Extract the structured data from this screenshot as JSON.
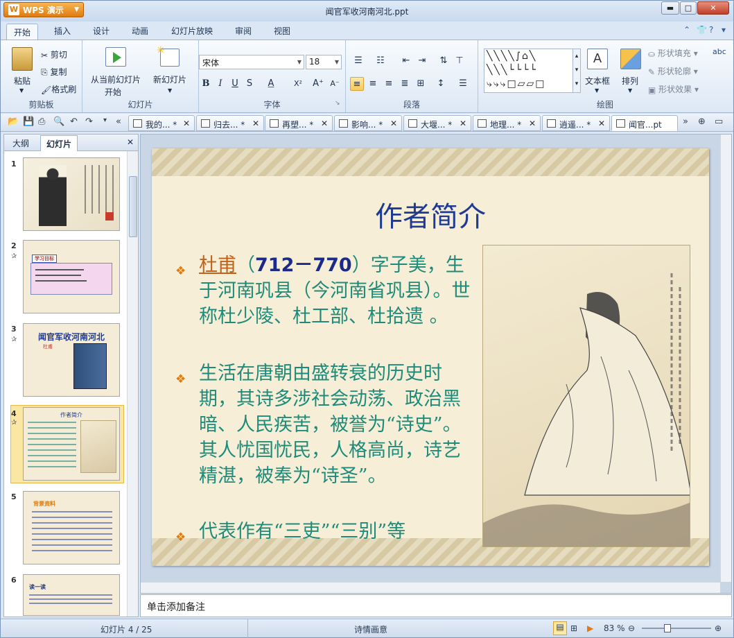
{
  "app": {
    "name": "WPS 演示",
    "window_title": "闻官军收河南河北.ppt"
  },
  "window_controls": {
    "minimize": "▬",
    "maximize": "□",
    "close": "✕"
  },
  "ribbon_tabs": [
    "开始",
    "插入",
    "设计",
    "动画",
    "幻灯片放映",
    "审阅",
    "视图"
  ],
  "clipboard": {
    "paste": "粘贴",
    "cut": "剪切",
    "copy": "复制",
    "format_painter": "格式刷",
    "group": "剪贴板"
  },
  "slides_group": {
    "from_current": "从当前幻灯片",
    "from_current_2": "开始",
    "new_slide": "新幻灯片",
    "group": "幻灯片"
  },
  "font_group": {
    "font_name": "宋体",
    "font_size": "18",
    "bold": "B",
    "italic": "I",
    "underline": "U",
    "strike": "S",
    "font_color": "A",
    "superscript": "X²",
    "grow": "A⁺",
    "shrink": "A⁻",
    "group": "字体"
  },
  "paragraph_group": {
    "group": "段落"
  },
  "drawing_group": {
    "textbox": "文本框",
    "arrange": "排列",
    "shape_fill": "形状填充",
    "shape_outline": "形状轮廓",
    "shape_effects": "形状效果",
    "group": "绘图",
    "abc": "abc"
  },
  "doc_tabs": [
    {
      "label": "我的... *"
    },
    {
      "label": "归去... *"
    },
    {
      "label": "再塑... *"
    },
    {
      "label": "影响... *"
    },
    {
      "label": "大堰... *"
    },
    {
      "label": "地理... *"
    },
    {
      "label": "逍遥... *"
    },
    {
      "label": "闻官...pt"
    }
  ],
  "side_tabs": {
    "outline": "大纲",
    "slides": "幻灯片"
  },
  "thumbnails": [
    {
      "num": "1",
      "title": ""
    },
    {
      "num": "2",
      "title": "学习目标"
    },
    {
      "num": "3",
      "title": "闻官军收河南河北",
      "sub": "杜甫"
    },
    {
      "num": "4",
      "title": "作者简介"
    },
    {
      "num": "5",
      "title": "背景资料"
    },
    {
      "num": "6",
      "title": "读一读"
    }
  ],
  "slide": {
    "title": "作者简介",
    "p1_name": "杜甫",
    "p1_paren_open": "（",
    "p1_years": "712－770",
    "p1_rest": "）字子美，生于河南巩县（今河南省巩县）。世称杜少陵、杜工部、杜拾遗 。",
    "p2": "生活在唐朝由盛转衰的历史时期，其诗多涉社会动荡、政治黑暗、人民疾苦，被誉为“诗史”。其人忧国忧民，人格高尚，诗艺精湛，被奉为“诗圣”。",
    "p3": "代表作有“三吏”“三别”等",
    "bullet": "❖"
  },
  "notes_placeholder": "单击添加备注",
  "status": {
    "slide_pos": "幻灯片 4 / 25",
    "theme": "诗情画意",
    "zoom": "83 %"
  }
}
